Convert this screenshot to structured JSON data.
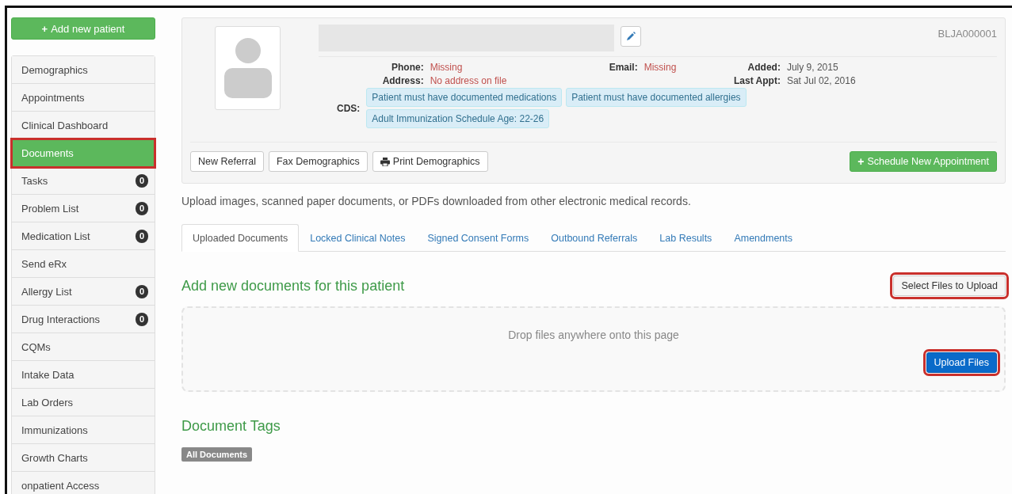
{
  "sidebar": {
    "add_button": {
      "icon": "+",
      "label": "Add new patient"
    },
    "items": [
      {
        "label": "Demographics",
        "selected": false,
        "highlighted": false
      },
      {
        "label": "Appointments",
        "selected": false,
        "highlighted": false
      },
      {
        "label": "Clinical Dashboard",
        "selected": false,
        "highlighted": false
      },
      {
        "label": "Documents",
        "selected": true,
        "highlighted": true
      },
      {
        "label": "Tasks",
        "badge": "0",
        "selected": false,
        "highlighted": false
      },
      {
        "label": "Problem List",
        "badge": "0",
        "selected": false,
        "highlighted": false
      },
      {
        "label": "Medication List",
        "badge": "0",
        "selected": false,
        "highlighted": false
      },
      {
        "label": "Send eRx",
        "selected": false,
        "highlighted": false
      },
      {
        "label": "Allergy List",
        "badge": "0",
        "selected": false,
        "highlighted": false
      },
      {
        "label": "Drug Interactions",
        "badge": "0",
        "selected": false,
        "highlighted": false
      },
      {
        "label": "CQMs",
        "selected": false,
        "highlighted": false
      },
      {
        "label": "Intake Data",
        "selected": false,
        "highlighted": false
      },
      {
        "label": "Lab Orders",
        "selected": false,
        "highlighted": false
      },
      {
        "label": "Immunizations",
        "selected": false,
        "highlighted": false
      },
      {
        "label": "Growth Charts",
        "selected": false,
        "highlighted": false
      },
      {
        "label": "onpatient Access",
        "selected": false,
        "highlighted": false
      }
    ]
  },
  "patient": {
    "chart_id": "BLJA000001",
    "left_fields": [
      {
        "label": "Phone:",
        "value": "Missing",
        "missing": true
      },
      {
        "label": "Address:",
        "value": "No address on file",
        "missing": true
      }
    ],
    "mid_fields": [
      {
        "label": "Email:",
        "value": "Missing",
        "missing": true
      }
    ],
    "right_fields": [
      {
        "label": "Added:",
        "value": "July 9, 2015",
        "missing": false
      },
      {
        "label": "Last Appt:",
        "value": "Sat Jul 02, 2016",
        "missing": false
      }
    ],
    "cds_label": "CDS:",
    "cds_alerts": [
      "Patient must have documented medications",
      "Patient must have documented allergies",
      "Adult Immunization Schedule Age: 22-26"
    ],
    "actions": [
      {
        "label": "New Referral"
      },
      {
        "label": "Fax Demographics"
      },
      {
        "label": "Print Demographics",
        "kind": "print"
      }
    ],
    "schedule_button": {
      "icon": "+",
      "label": "Schedule New Appointment"
    }
  },
  "description": "Upload images, scanned paper documents, or PDFs downloaded from other electronic medical records.",
  "tabs": [
    {
      "label": "Uploaded Documents",
      "selected": true
    },
    {
      "label": "Locked Clinical Notes",
      "selected": false
    },
    {
      "label": "Signed Consent Forms",
      "selected": false
    },
    {
      "label": "Outbound Referrals",
      "selected": false
    },
    {
      "label": "Lab Results",
      "selected": false
    },
    {
      "label": "Amendments",
      "selected": false
    }
  ],
  "upload": {
    "heading": "Add new documents for this patient",
    "select_button": {
      "label": "Select Files to Upload",
      "highlighted": true
    },
    "drop_hint": "Drop files anywhere onto this page",
    "upload_button": {
      "label": "Upload Files",
      "highlighted": true
    }
  },
  "tags": {
    "heading": "Document Tags",
    "items": [
      "All Documents"
    ]
  }
}
